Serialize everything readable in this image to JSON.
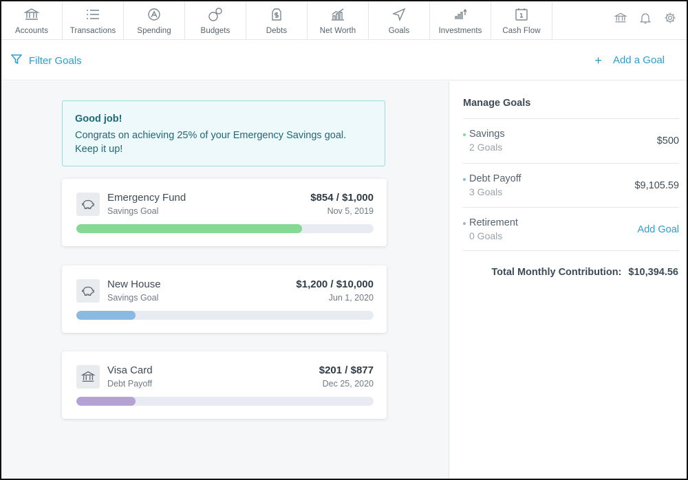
{
  "nav": {
    "items": [
      {
        "label": "Accounts",
        "icon": "bank-icon"
      },
      {
        "label": "Transactions",
        "icon": "list-icon"
      },
      {
        "label": "Spending",
        "icon": "spending-icon"
      },
      {
        "label": "Budgets",
        "icon": "budgets-icon"
      },
      {
        "label": "Debts",
        "icon": "debts-icon"
      },
      {
        "label": "Net Worth",
        "icon": "net-worth-icon"
      },
      {
        "label": "Goals",
        "icon": "goals-icon"
      },
      {
        "label": "Investments",
        "icon": "investments-icon"
      },
      {
        "label": "Cash Flow",
        "icon": "calendar-icon"
      }
    ],
    "right_icons": [
      "bank-icon",
      "bell-icon",
      "gear-icon"
    ]
  },
  "filterbar": {
    "filter_label": "Filter Goals",
    "add_label": "Add a Goal",
    "add_icon": "plus-icon"
  },
  "alert": {
    "title": "Good job!",
    "message": "Congrats on achieving 25% of your Emergency Savings goal. Keep it up!"
  },
  "goals": [
    {
      "name": "Emergency Fund",
      "type": "Savings Goal",
      "amount": "$854 / $1,000",
      "date": "Nov 5, 2019",
      "icon": "piggy-bank-icon",
      "progress": 0.76,
      "color": "#86d992"
    },
    {
      "name": "New House",
      "type": "Savings Goal",
      "amount": "$1,200 / $10,000",
      "date": "Jun 1, 2020",
      "icon": "piggy-bank-icon",
      "progress": 0.2,
      "color": "#8ab9e2"
    },
    {
      "name": "Visa Card",
      "type": "Debt Payoff",
      "amount": "$201 / $877",
      "date": "Dec 25, 2020",
      "icon": "bank-icon",
      "progress": 0.2,
      "color": "#b4a2d6"
    }
  ],
  "manage": {
    "title": "Manage Goals",
    "rows": [
      {
        "name": "Savings",
        "count": "2 Goals",
        "value": "$500",
        "dot_color": "#86d992"
      },
      {
        "name": "Debt Payoff",
        "count": "3 Goals",
        "value": "$9,105.59",
        "dot_color": "#8ab9e2"
      },
      {
        "name": "Retirement",
        "count": "0 Goals",
        "link": "Add Goal",
        "dot_color": "#a9b2ba"
      }
    ],
    "total_label": "Total Monthly Contribution:",
    "total_value": "$10,394.56"
  },
  "colors": {
    "accent": "#2a9fd0",
    "alert_bg": "#eef9fb",
    "alert_border": "#9fd8df"
  }
}
